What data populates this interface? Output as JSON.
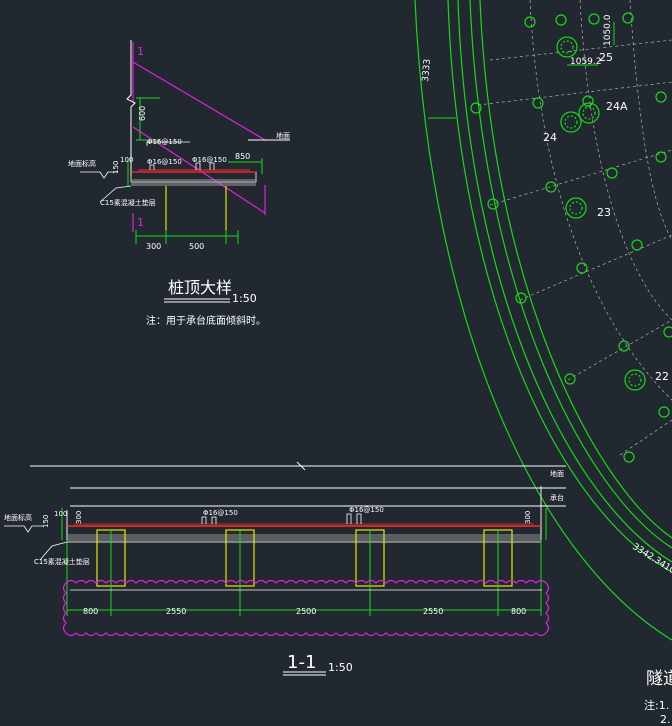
{
  "pile_detail": {
    "title": "桩顶大样",
    "scale": "1:50",
    "note": "注：用于承台底面倾斜时。",
    "marks": {
      "section_mark": "1",
      "level_mark": "地面"
    },
    "labels": {
      "top_rebar": "Φ16@150",
      "inner_rebar_a": "Φ16@150",
      "inner_rebar_b": "Φ16@150",
      "ground_label": "地面标高",
      "cushion_label": "C15素混凝土垫层"
    },
    "dims": {
      "d600": "600",
      "d100": "100",
      "d150": "150",
      "d850": "850",
      "d300": "300",
      "d500": "500"
    }
  },
  "section_1_1": {
    "title": "1-1",
    "scale": "1:50",
    "labels": {
      "rebar_a": "Φ16@150",
      "rebar_b": "Φ16@150",
      "ground_label": "地面标高",
      "cushion_label": "C15素混凝土垫层",
      "mark_top": "地面",
      "mark_bottom": "承台"
    },
    "dims": {
      "left_100": "100",
      "left_150": "150",
      "left_300": "300",
      "right_300": "300",
      "bottom": [
        "800",
        "2550",
        "2500",
        "2550",
        "800"
      ]
    }
  },
  "plan": {
    "dim_left": "3333",
    "dim_top": "1050.0",
    "dim_mid": "1059.2",
    "pile_labels": [
      "25",
      "24A",
      "24",
      "23",
      "22"
    ],
    "arc_label": "3342.3410-3",
    "corner_title": "隧道",
    "corner_note": "注:1.",
    "corner_note2": "2."
  }
}
